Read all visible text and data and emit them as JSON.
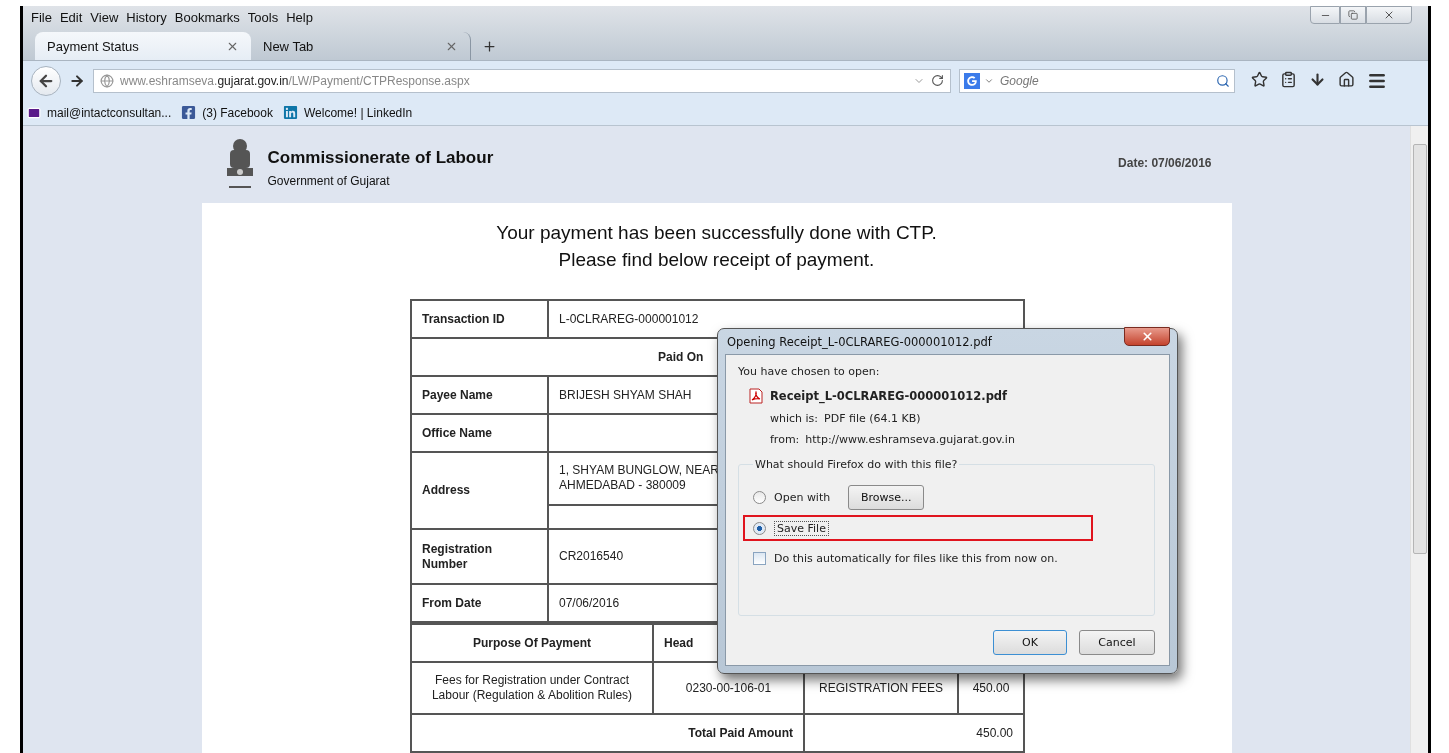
{
  "browser": {
    "menu": [
      "File",
      "Edit",
      "View",
      "History",
      "Bookmarks",
      "Tools",
      "Help"
    ],
    "tabs": [
      {
        "label": "Payment Status",
        "selected": true
      },
      {
        "label": "New Tab",
        "selected": false
      }
    ],
    "url": {
      "prefix": "www.eshramseva.",
      "domain": "gujarat.gov.in",
      "path": "/LW/Payment/CTPResponse.aspx"
    },
    "search": {
      "placeholder": "Google"
    },
    "bookmarks": [
      {
        "kind": "mail",
        "label": "mail@intactconsultan..."
      },
      {
        "kind": "facebook",
        "label": "(3) Facebook"
      },
      {
        "kind": "linkedin",
        "label": "Welcome! | LinkedIn"
      }
    ]
  },
  "page": {
    "title": "Commissionerate of Labour",
    "subtitle": "Government of Gujarat",
    "date": "Date: 07/06/2016",
    "message": [
      "Your payment has been successfully done with CTP.",
      "Please find below receipt of payment."
    ],
    "details": [
      {
        "kind": "pair",
        "label": "Transaction ID",
        "value": [
          "L-0CLRAREG-000001012"
        ]
      },
      {
        "kind": "banner",
        "label": "Paid On"
      },
      {
        "kind": "pair",
        "label": "Payee Name",
        "value": [
          "BRIJESH SHYAM SHAH"
        ]
      },
      {
        "kind": "pair",
        "label": "Office Name"
      },
      {
        "kind": "split",
        "label": "Address",
        "value": [
          "1, SHYAM BUNGLOW, NEAR",
          "AHMEDABAD - 380009"
        ]
      },
      {
        "kind": "pair",
        "label": "Registration Number",
        "value": [
          "CR2016540"
        ]
      },
      {
        "kind": "pair",
        "label": "From Date",
        "value": [
          "07/06/2016"
        ]
      }
    ],
    "payments": {
      "columns": [
        "Purpose Of Payment",
        "Head"
      ],
      "rows": [
        [
          "Fees for Registration under Contract Labour (Regulation & Abolition Rules)",
          "0230-00-106-01",
          "REGISTRATION FEES",
          "450.00"
        ]
      ]
    },
    "total": {
      "label": "Total Paid Amount",
      "value": "450.00"
    }
  },
  "dialog": {
    "title": "Opening Receipt_L-0CLRAREG-000001012.pdf",
    "intro": "You have chosen to open:",
    "file": "Receipt_L-0CLRAREG-000001012.pdf",
    "type_label": "which is:",
    "type": "PDF file (64.1 KB)",
    "from_label": "from:",
    "from": "http://www.eshramseva.gujarat.gov.in",
    "question": "What should Firefox do with this file?",
    "options": [
      {
        "label": "Open with",
        "selected": false,
        "highlighted": false
      },
      {
        "label": "Save File",
        "selected": true,
        "highlighted": true
      }
    ],
    "browse": "Browse...",
    "auto": {
      "label": "Do this automatically for files like this from now on.",
      "checked": false
    },
    "buttons": [
      {
        "label": "OK",
        "default": true
      },
      {
        "label": "Cancel",
        "default": false
      }
    ]
  }
}
